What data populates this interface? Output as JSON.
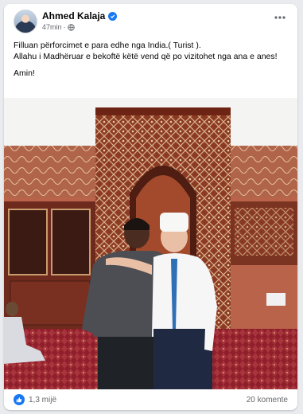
{
  "post": {
    "author": "Ahmed Kalaja",
    "time": "47min",
    "separator": "·",
    "text_line1": "Filluan përforcimet e para edhe nga India.( Turist ).",
    "text_line2": "Allahu i Madhëruar e bekoftë këtë vend që po vizitohet nga ana e anes!",
    "text_line3": "Amin!",
    "reaction_count": "1,3 mijë",
    "comment_count": "20 komente"
  },
  "icons": {
    "verified": "verified-badge-icon",
    "privacy": "globe-icon",
    "menu": "more-options-icon",
    "reaction": "like-icon"
  },
  "colors": {
    "brand_blue": "#1877f2",
    "text_primary": "#050505",
    "text_secondary": "#65676b"
  }
}
